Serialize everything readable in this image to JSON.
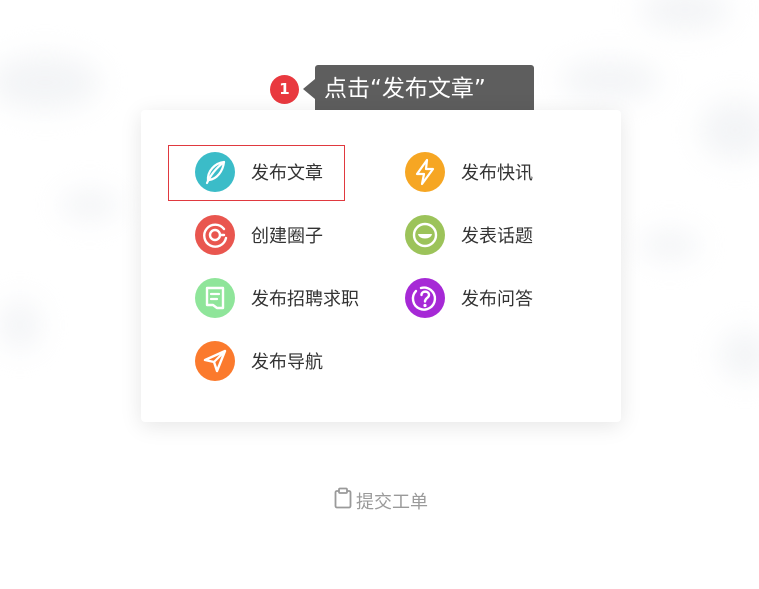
{
  "annotation": {
    "step": "1",
    "tooltip": "点击“发布文章”"
  },
  "menu": {
    "items": [
      {
        "label": "发布文章",
        "icon": "feather-icon",
        "color": "#3bbcc8"
      },
      {
        "label": "发布快讯",
        "icon": "lightning-icon",
        "color": "#f6a623"
      },
      {
        "label": "创建圈子",
        "icon": "circle-group-icon",
        "color": "#e9564f"
      },
      {
        "label": "发表话题",
        "icon": "chat-bubble-icon",
        "color": "#9cc35a"
      },
      {
        "label": "发布招聘求职",
        "icon": "document-icon",
        "color": "#8fe59a"
      },
      {
        "label": "发布问答",
        "icon": "question-icon",
        "color": "#a629d6"
      },
      {
        "label": "发布导航",
        "icon": "send-icon",
        "color": "#fb7a2d"
      }
    ]
  },
  "footer": {
    "ticket_label": "提交工单",
    "ticket_icon": "clipboard-icon"
  },
  "colors": {
    "highlight": "#e0393f",
    "tooltip_bg": "#5e5e5e",
    "badge": "#e9393f"
  }
}
